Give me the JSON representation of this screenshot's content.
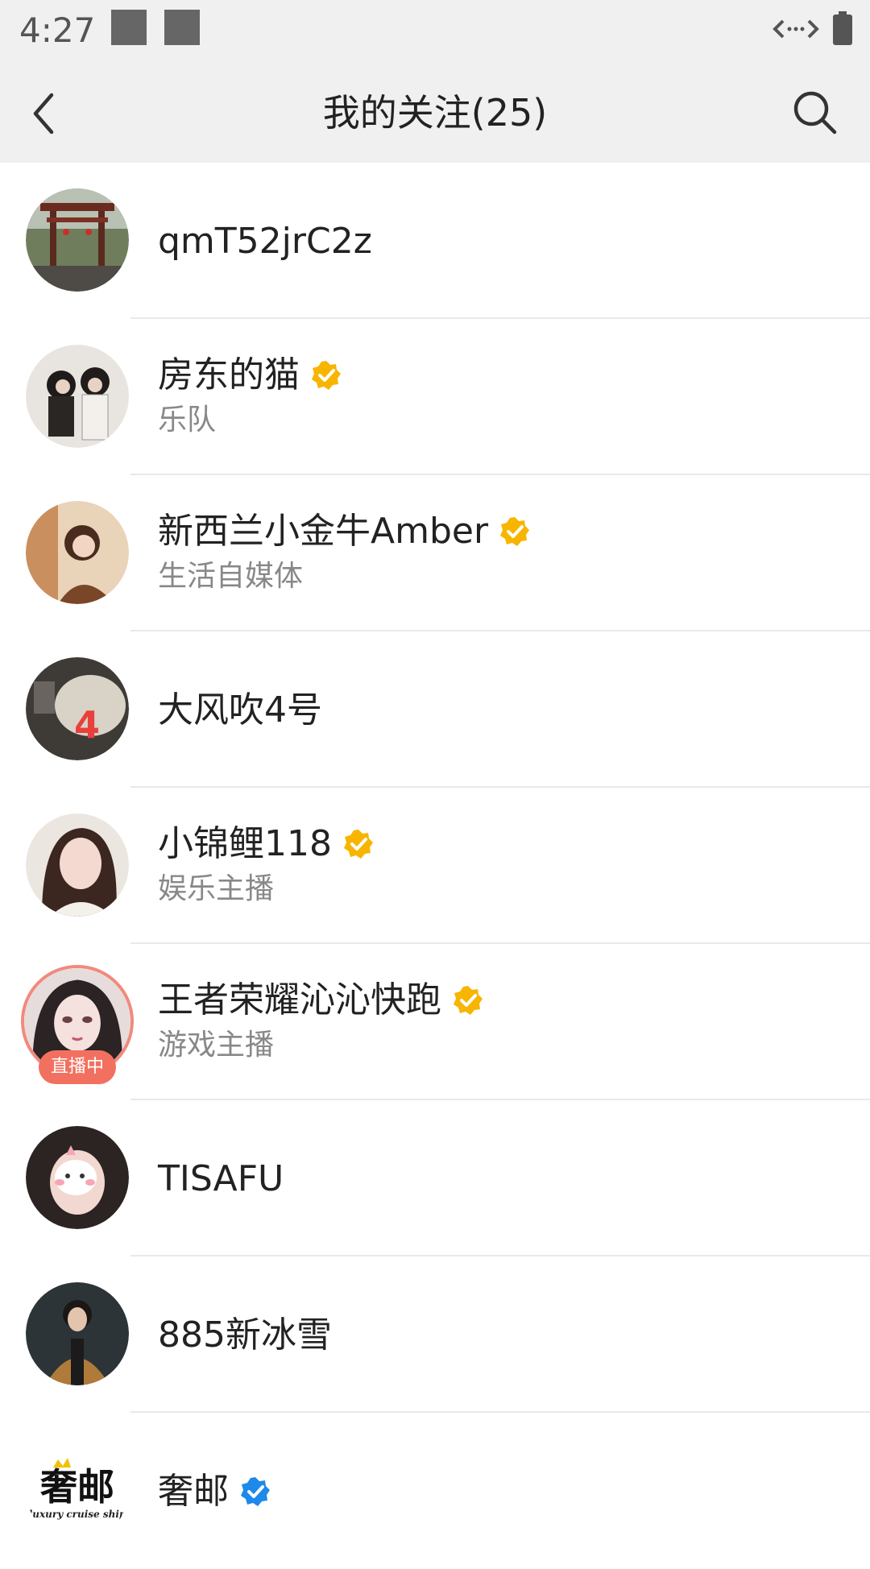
{
  "status_bar": {
    "time": "4:27",
    "icons": [
      "notification-square-icon",
      "notification-square-icon",
      "data-arrows-icon",
      "battery-icon"
    ]
  },
  "header": {
    "title": "我的关注(25)",
    "back_icon": "chevron-left-icon",
    "search_icon": "search-icon"
  },
  "colors": {
    "verified_gold": "#f7b500",
    "verified_blue": "#1d89ea",
    "live_red": "#f2705f"
  },
  "follows": [
    {
      "name": "qmT52jrC2z",
      "subtitle": "",
      "verified": ""
    },
    {
      "name": "房东的猫",
      "subtitle": "乐队",
      "verified": "gold"
    },
    {
      "name": "新西兰小金牛Amber",
      "subtitle": "生活自媒体",
      "verified": "gold"
    },
    {
      "name": "大风吹4号",
      "subtitle": "",
      "verified": ""
    },
    {
      "name": "小锦鲤118",
      "subtitle": "娱乐主播",
      "verified": "gold"
    },
    {
      "name": "王者荣耀沁沁快跑",
      "subtitle": "游戏主播",
      "verified": "gold",
      "live_label": "直播中"
    },
    {
      "name": "TISAFU",
      "subtitle": "",
      "verified": ""
    },
    {
      "name": "885新冰雪",
      "subtitle": "",
      "verified": ""
    },
    {
      "name": "奢邮",
      "subtitle": "",
      "verified": "blue",
      "avatar_logo_text": "奢邮",
      "avatar_logo_subtext": "luxury cruise ship"
    }
  ]
}
